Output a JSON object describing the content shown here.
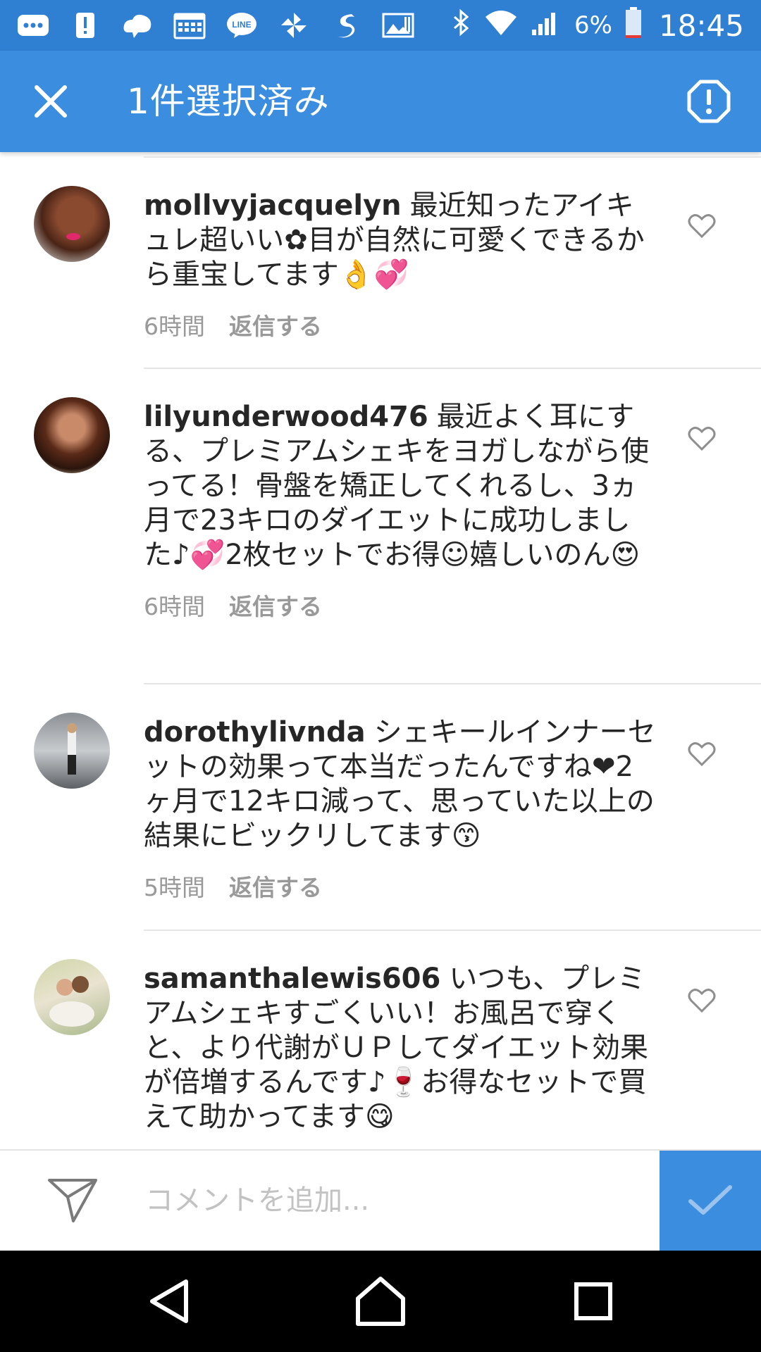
{
  "status_bar": {
    "battery_percent": "6%",
    "time": "18:45",
    "left_icons": [
      "chat-bubble-icon",
      "alert-icon",
      "cloud-icon",
      "calendar-icon",
      "line-app-icon",
      "pinwheel-icon",
      "swirl-app-icon",
      "gallery-icon"
    ]
  },
  "header": {
    "title": "1件選択済み",
    "close_icon": "close-icon",
    "report_icon": "report-icon"
  },
  "comments": [
    {
      "username": "mollvyjacquelyn",
      "text": "最近知ったアイキュレ超いい✿目が自然に可愛くできるから重宝してます👌💞",
      "time": "6時間",
      "reply": "返信する"
    },
    {
      "username": "lilyunderwood476",
      "text": "最近よく耳にする、プレミアムシェキをヨガしながら使ってる！骨盤を矯正してくれるし、3ヵ月で23キロのダイエットに成功しました♪💞2枚セットでお得☺嬉しいのん😍",
      "time": "6時間",
      "reply": "返信する"
    },
    {
      "username": "dorothylivnda",
      "text": "シェキールインナーセットの効果って本当だったんですね❤2ヶ月で12キロ減って、思っていた以上の結果にビックリしてます😙",
      "time": "5時間",
      "reply": "返信する"
    },
    {
      "username": "samanthalewis606",
      "text": "いつも、プレミアムシェキすごくいい！お風呂で穿くと、より代謝がＵＰしてダイエット効果が倍増するんです♪🍷お得なセットで買えて助かってます😋"
    }
  ],
  "comment_bar": {
    "placeholder": "コメントを追加...",
    "send_icon": "send-icon",
    "confirm_icon": "checkmark-icon"
  },
  "navigation": {
    "back_icon": "back-triangle-icon",
    "home_icon": "home-icon",
    "recents_icon": "recents-square-icon"
  },
  "colors": {
    "status_bar": "#2f7fd3",
    "app_bar": "#3b8de0",
    "meta_text": "#999999",
    "divider": "#e6e6e6"
  }
}
